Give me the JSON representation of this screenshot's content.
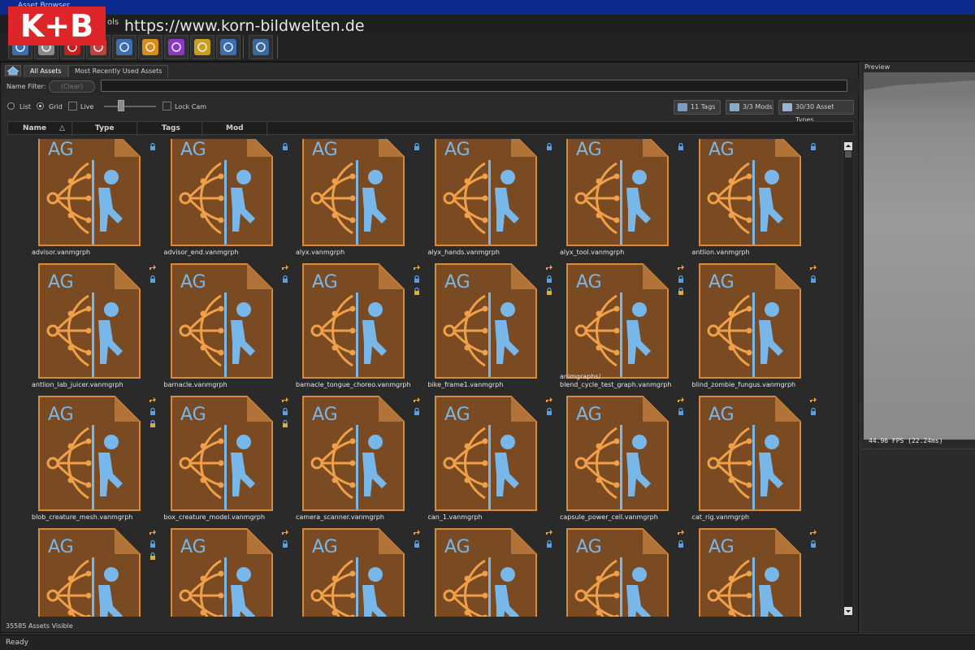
{
  "window": {
    "title": "Asset Browser"
  },
  "watermark": {
    "logo_text": "K+B",
    "url": "https://www.korn-bildwelten.de"
  },
  "menubar": {
    "items": [
      "ols"
    ]
  },
  "toolbar": {
    "buttons": [
      {
        "name": "grid-tool-icon",
        "color": "#3b6fb0"
      },
      {
        "name": "material-tool-icon",
        "color": "#8a8a8a"
      },
      {
        "name": "model-tool-icon",
        "color": "#c02020"
      },
      {
        "name": "paint-tool-icon",
        "color": "#c04040"
      },
      {
        "name": "particle-tool-icon",
        "color": "#3b6fb0"
      },
      {
        "name": "tile-tool-icon",
        "color": "#d88c1a"
      },
      {
        "name": "color-wheel-icon",
        "color": "#8a3ac0"
      },
      {
        "name": "film-reel-icon",
        "color": "#c8a020"
      },
      {
        "name": "steam-tool-icon",
        "color": "#3b6fb0"
      },
      {
        "name": "monitor-icon",
        "color": "#3a6a9a"
      }
    ]
  },
  "tabs": [
    {
      "label": "All Assets",
      "active": true
    },
    {
      "label": "Most Recently Used Assets",
      "active": false
    }
  ],
  "filter": {
    "label": "Name Filter:",
    "clear_label": "(Clear)",
    "value": ""
  },
  "options": {
    "list_label": "List",
    "grid_label": "Grid",
    "live_label": "Live",
    "lockcam_label": "Lock Cam",
    "view_mode": "Grid"
  },
  "summary_buttons": {
    "tags": "11 Tags",
    "mods": "3/3 Mods",
    "types": "30/30 Asset Types"
  },
  "columns": [
    "Name",
    "Type",
    "Tags",
    "Mod"
  ],
  "thumb": {
    "label": "AG",
    "bg": "#7a4a22",
    "fold": "#b27338",
    "border": "#d9893a",
    "graph": "#f0a048",
    "figure": "#78b7ea"
  },
  "assets": [
    {
      "name": "advisor.vanmgrph",
      "icons": 2
    },
    {
      "name": "advisor_end.vanmgrph",
      "icons": 2
    },
    {
      "name": "alyx.vanmgrph",
      "icons": 2
    },
    {
      "name": "alyx_hands.vanmgrph",
      "icons": 2
    },
    {
      "name": "alyx_tool.vanmgrph",
      "icons": 2
    },
    {
      "name": "antlion.vanmgrph",
      "icons": 2
    },
    {
      "name": "antlion_lab_juicer.vanmgrph",
      "icons": 2
    },
    {
      "name": "barnacle.vanmgrph",
      "icons": 2
    },
    {
      "name": "barnacle_tongue_choreo.vanmgrph",
      "icons": 3
    },
    {
      "name": "bike_frame1.vanmgrph",
      "icons": 3
    },
    {
      "name": "animgraphs/\nblend_cycle_test_graph.vanmgrph",
      "icons": 3
    },
    {
      "name": "blind_zombie_fungus.vanmgrph",
      "icons": 2
    },
    {
      "name": "blob_creature_mesh.vanmgrph",
      "icons": 3
    },
    {
      "name": "box_creature_model.vanmgrph",
      "icons": 3
    },
    {
      "name": "camera_scanner.vanmgrph",
      "icons": 2
    },
    {
      "name": "can_1.vanmgrph",
      "icons": 2
    },
    {
      "name": "capsule_power_cell.vanmgrph",
      "icons": 2
    },
    {
      "name": "cat_rig.vanmgrph",
      "icons": 2
    },
    {
      "name": "",
      "icons": 3
    },
    {
      "name": "",
      "icons": 2
    },
    {
      "name": "",
      "icons": 2
    },
    {
      "name": "",
      "icons": 2
    },
    {
      "name": "",
      "icons": 2
    },
    {
      "name": "",
      "icons": 2
    }
  ],
  "status": {
    "visible_count": "35585 Assets Visible",
    "ready": "Ready"
  },
  "preview": {
    "title": "Preview",
    "fps": "44.96 FPS (22.24ms)"
  }
}
